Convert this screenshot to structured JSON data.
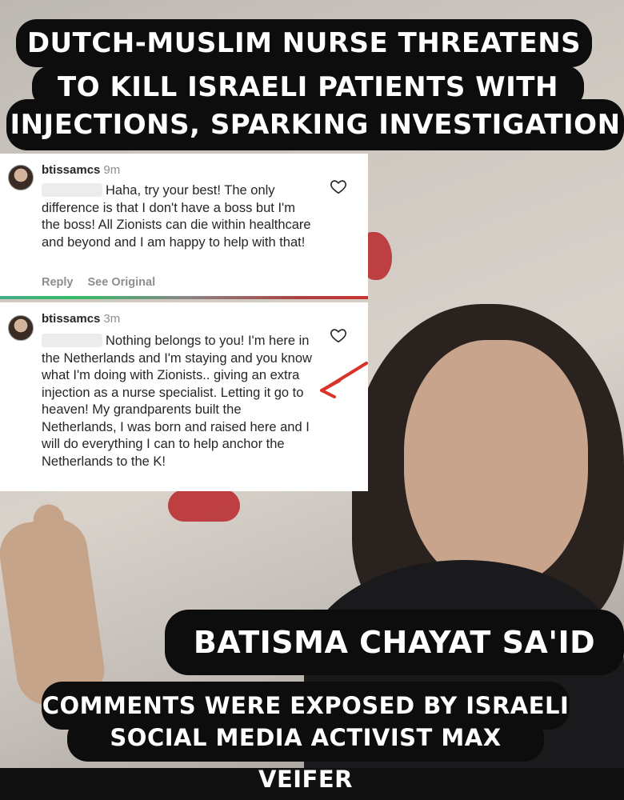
{
  "headline": {
    "lines": [
      "DUTCH-MUSLIM NURSE THREATENS",
      "TO KILL ISRAELI PATIENTS WITH",
      "INJECTIONS, SPARKING INVESTIGATION"
    ]
  },
  "comments": [
    {
      "username": "btissamcs",
      "time": "9m",
      "text": "Haha, try your best! The only difference is that I don't have a boss but I'm the boss! All Zionists can die within healthcare and beyond and I am happy to help with that!",
      "reply_label": "Reply",
      "see_original_label": "See Original",
      "icon": "heart-icon"
    },
    {
      "username": "btissamcs",
      "time": "3m",
      "text": "Nothing belongs to you! I'm here in the Netherlands and I'm staying and you know what I'm doing with Zionists.. giving an extra injection as a nurse specialist. Letting it go to heaven! My grandparents built the Netherlands, I was born and raised here and I will do everything I can to help anchor the Netherlands to the K!",
      "icon": "heart-icon"
    }
  ],
  "name_caption": "BATISMA CHAYAT SA'ID",
  "source_caption": {
    "lines": [
      "COMMENTS WERE EXPOSED BY ISRAELI",
      "SOCIAL MEDIA ACTIVIST MAX VEIFER"
    ]
  },
  "colors": {
    "caption_bg": "#0d0d0d",
    "caption_text": "#ffffff",
    "arrow": "#d9342b",
    "muted": "#8e8e8e"
  }
}
